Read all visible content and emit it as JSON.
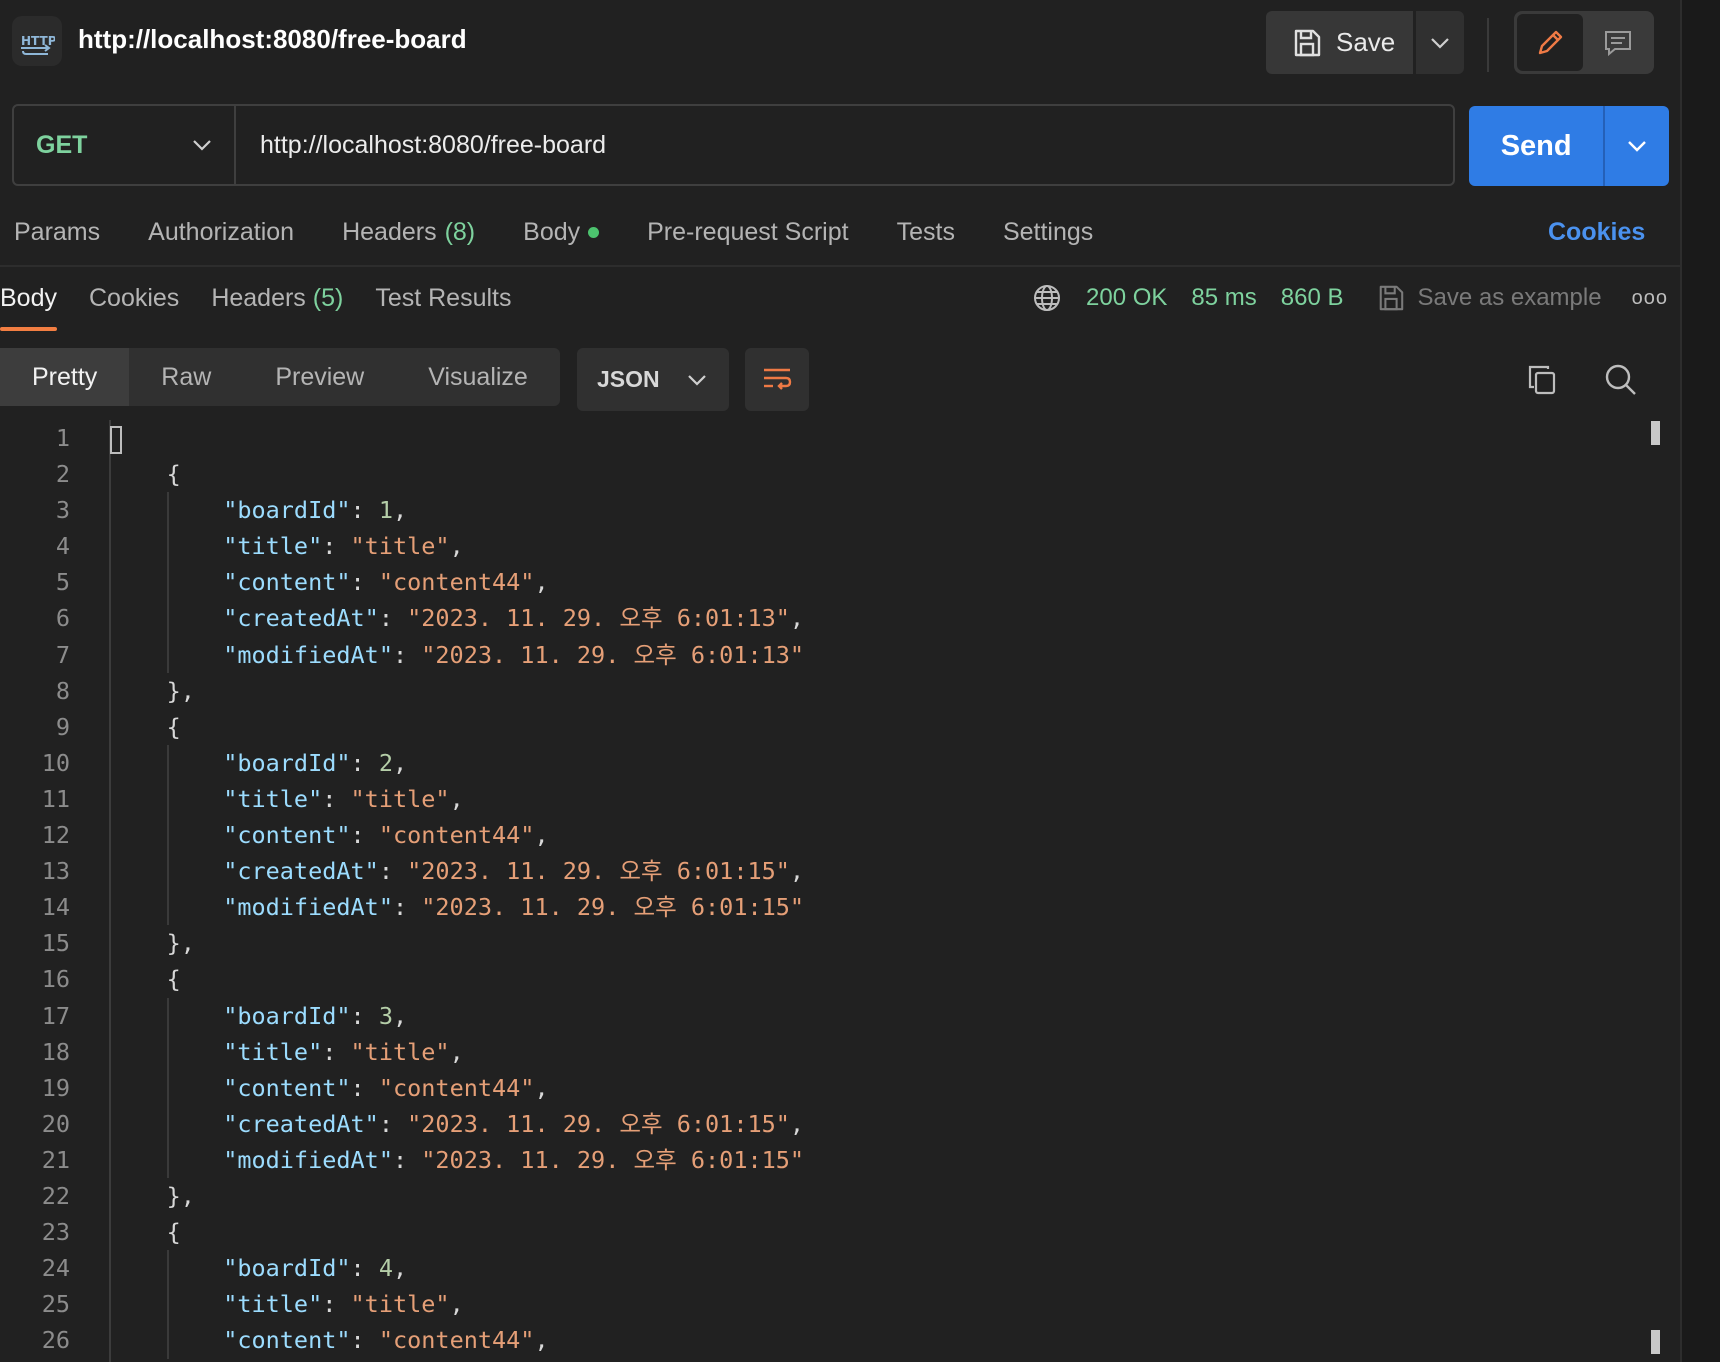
{
  "header": {
    "badge_label": "HTTP",
    "request_name": "http://localhost:8080/free-board",
    "save_label": "Save"
  },
  "request": {
    "method": "GET",
    "url": "http://localhost:8080/free-board",
    "send_label": "Send"
  },
  "request_tabs": {
    "params": "Params",
    "authorization": "Authorization",
    "headers": "Headers",
    "headers_count": "(8)",
    "body": "Body",
    "pre_request": "Pre-request Script",
    "tests": "Tests",
    "settings": "Settings",
    "cookies": "Cookies"
  },
  "response_tabs": {
    "body": "Body",
    "cookies": "Cookies",
    "headers": "Headers",
    "headers_count": "(5)",
    "test_results": "Test Results"
  },
  "response_meta": {
    "status": "200 OK",
    "time": "85 ms",
    "size": "860 B",
    "save_example": "Save as example",
    "more": "ooo"
  },
  "view": {
    "tabs": [
      "Pretty",
      "Raw",
      "Preview",
      "Visualize"
    ],
    "active_tab": "Pretty",
    "format": "JSON"
  },
  "colors": {
    "accent_blue": "#2f7ce5",
    "status_green": "#7ed29e",
    "active_tab_orange": "#f27e42",
    "json_key": "#9cdcfe",
    "json_string": "#e59f77",
    "json_number": "#b5cea8"
  },
  "icons": [
    "http-icon",
    "save-icon",
    "chevron-down-icon",
    "pencil-icon",
    "comment-icon",
    "globe-icon",
    "copy-icon",
    "search-icon",
    "wrap-lines-icon"
  ],
  "editor": {
    "records": [
      {
        "boardId": "1",
        "title": "\"title\"",
        "content": "\"content44\"",
        "createdAt": "\"2023. 11. 29. 오후 6:01:13\"",
        "modifiedAt": "\"2023. 11. 29. 오후 6:01:13\""
      },
      {
        "boardId": "2",
        "title": "\"title\"",
        "content": "\"content44\"",
        "createdAt": "\"2023. 11. 29. 오후 6:01:15\"",
        "modifiedAt": "\"2023. 11. 29. 오후 6:01:15\""
      },
      {
        "boardId": "3",
        "title": "\"title\"",
        "content": "\"content44\"",
        "createdAt": "\"2023. 11. 29. 오후 6:01:15\"",
        "modifiedAt": "\"2023. 11. 29. 오후 6:01:15\""
      },
      {
        "boardId": "4",
        "title": "\"title\"",
        "content": "\"content44\""
      }
    ]
  }
}
